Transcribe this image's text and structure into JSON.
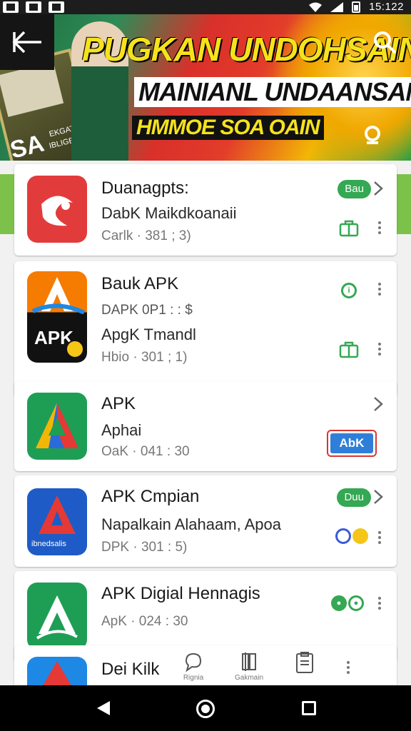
{
  "status_bar": {
    "time": "15:122"
  },
  "banner": {
    "title_line1": "PUGKAN UNDOHSAIN",
    "title_line2": "MAINIANL UNDAANSAN",
    "title_line3": "HMMOE SOA OAIN",
    "photo_text_line1": "EKGAT",
    "photo_text_line2": "IBLIGEIOH",
    "photo_text_big": "SA",
    "back_icon": "back-arrow-icon",
    "search_icon": "search-icon",
    "chat_icon": "chat-icon"
  },
  "apps": [
    {
      "title": "Duanagpts:",
      "subtitle": "DabK Maikdkoanaii",
      "meta": "Carlk · 381 ; 3)",
      "badge": "Bau",
      "icon_color": "#e53935"
    },
    {
      "title": "Bauk APK",
      "subtitle": "DAPK 0P1 : : $",
      "title2": "ApgK Tmandl",
      "meta": "Hbio · 301 ; 1)",
      "icon_text": "APK",
      "icon_color": "#f57c00"
    },
    {
      "title": "APK",
      "subtitle": "Aphai",
      "meta": "OaK · 041 : 30",
      "button": "AbK",
      "icon_color": "#1e9e55"
    },
    {
      "title": "APK Cmpian",
      "subtitle": "Napalkain Alahaam, Apoa",
      "meta": "DPK · 301 : 5)",
      "badge": "Duu",
      "icon_caption": "ibnedsalis",
      "icon_color": "#1e5bc6"
    },
    {
      "title": "APK Digial Hennagis",
      "meta": "ApK · 024 : 30",
      "icon_color": "#1e9e55"
    },
    {
      "title": "Dei Kilk",
      "icon_color": "#1e88e5"
    }
  ],
  "bottom_tabs": [
    {
      "label": "Rignia",
      "icon": "chat-bubble-icon"
    },
    {
      "label": "Gakmain",
      "icon": "book-icon"
    },
    {
      "label": "",
      "icon": "clipboard-icon"
    }
  ]
}
